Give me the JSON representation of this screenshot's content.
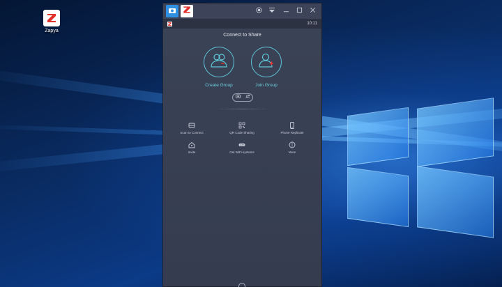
{
  "desktop": {
    "icon_label": "Zapya"
  },
  "emulator": {
    "titlebar_icons": [
      "home-icon",
      "zapya-icon"
    ],
    "controls": [
      "record-icon",
      "dropdown-icon",
      "minimize-icon",
      "maximize-icon",
      "close-icon"
    ],
    "status_time": "10:11"
  },
  "app": {
    "title": "Connect to Share",
    "create_group": "Create Group",
    "join_group": "Join Group",
    "options": [
      {
        "label": "Scan to Connect",
        "icon": "scan-icon"
      },
      {
        "label": "QR Code Sharing",
        "icon": "qr-code-icon"
      },
      {
        "label": "Phone Replicate",
        "icon": "phone-icon"
      },
      {
        "label": "Invite",
        "icon": "invite-icon"
      },
      {
        "label": "Get WiFi-systems",
        "icon": "wifi-icon"
      },
      {
        "label": "More",
        "icon": "more-icon"
      }
    ]
  },
  "colors": {
    "accent": "#5ec6d6",
    "panel": "#3a4256"
  }
}
